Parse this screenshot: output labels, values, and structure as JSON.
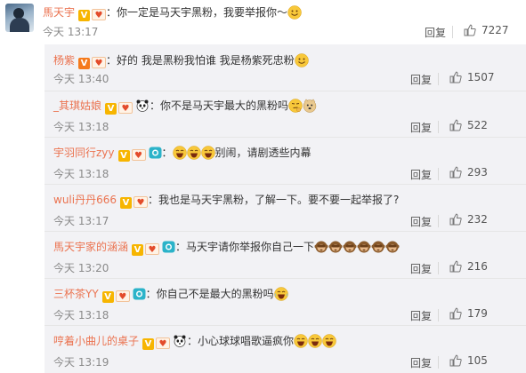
{
  "top": {
    "username": "馬天宇",
    "text": "：你一定是马天宇黑粉，我要举报你～",
    "time": "今天 13:17",
    "reply": "回复",
    "likes": "7227"
  },
  "replies": [
    {
      "username": "杨紫",
      "badges": [
        "v-orange",
        "heart"
      ],
      "text": "：好的 我是黑粉我怕谁 我是杨紫死忠粉",
      "emojis": [
        "smile"
      ],
      "time": "今天 13:40",
      "reply": "回复",
      "likes": "1507"
    },
    {
      "username": "_其琪姑娘",
      "badges": [
        "v",
        "heart",
        "panda"
      ],
      "text": "：你不是马天宇最大的黑粉吗",
      "emojis": [
        "think",
        "doge"
      ],
      "time": "今天 13:18",
      "reply": "回复",
      "likes": "522"
    },
    {
      "username": "宇羽同行zyy",
      "badges": [
        "v",
        "heart",
        "camera"
      ],
      "text": "别闹，请剧透些内幕",
      "emojis_before": [
        "laugh",
        "laugh",
        "laugh"
      ],
      "prefix": "：",
      "time": "今天 13:18",
      "reply": "回复",
      "likes": "293"
    },
    {
      "username": "wuli丹丹666",
      "badges": [
        "v",
        "heart"
      ],
      "text": "：我也是马天宇黑粉，了解一下。要不要一起举报了?",
      "emojis": [],
      "time": "今天 13:17",
      "reply": "回复",
      "likes": "232"
    },
    {
      "username": "馬天宇家的涵涵",
      "badges": [
        "v",
        "heart",
        "camera"
      ],
      "text": "：马天宇请你举报你自己一下",
      "emojis": [
        "monkey",
        "monkey",
        "monkey",
        "monkey",
        "monkey",
        "monkey"
      ],
      "time": "今天 13:20",
      "reply": "回复",
      "likes": "216"
    },
    {
      "username": "三杯茶YY",
      "badges": [
        "v",
        "heart",
        "camera"
      ],
      "text": "：你自己不是最大的黑粉吗",
      "emojis": [
        "laughcry"
      ],
      "time": "今天 13:18",
      "reply": "回复",
      "likes": "179"
    },
    {
      "username": "哼着小曲儿的桌子",
      "badges": [
        "v",
        "heart",
        "panda"
      ],
      "text": "：小心球球唱歌逼疯你",
      "emojis": [
        "laugh",
        "laugh",
        "laugh"
      ],
      "time": "今天 13:19",
      "reply": "回复",
      "likes": "105"
    }
  ],
  "colors": {
    "username": "#eb7350",
    "background_sub": "#f2f2f5",
    "badge_v": "#f7b500",
    "badge_v_orange": "#f57a1c"
  }
}
